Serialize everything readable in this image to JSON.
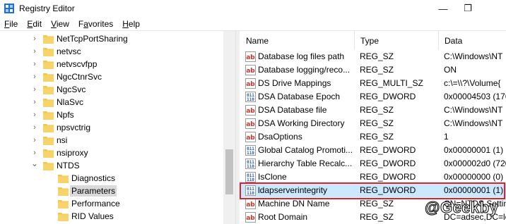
{
  "window": {
    "title": "Registry Editor",
    "controls": [
      "—",
      "❐"
    ]
  },
  "menu": [
    {
      "hotkey": "F",
      "rest": "ile"
    },
    {
      "hotkey": "E",
      "rest": "dit"
    },
    {
      "hotkey": "V",
      "rest": "iew"
    },
    {
      "hotkey": "",
      "rest": "Favorites",
      "u_index": 1
    },
    {
      "hotkey": "H",
      "rest": "elp"
    }
  ],
  "tree": {
    "items": [
      {
        "label": "NetTcpPortSharing",
        "expandable": true,
        "selected": false
      },
      {
        "label": "netvsc",
        "expandable": true,
        "selected": false
      },
      {
        "label": "netvscvfpp",
        "expandable": true,
        "selected": false
      },
      {
        "label": "NgcCtnrSvc",
        "expandable": true,
        "selected": false
      },
      {
        "label": "NgcSvc",
        "expandable": true,
        "selected": false
      },
      {
        "label": "NlaSvc",
        "expandable": true,
        "selected": false
      },
      {
        "label": "Npfs",
        "expandable": true,
        "selected": false
      },
      {
        "label": "npsvctrig",
        "expandable": true,
        "selected": false
      },
      {
        "label": "nsi",
        "expandable": true,
        "selected": false
      },
      {
        "label": "nsiproxy",
        "expandable": true,
        "selected": false
      },
      {
        "label": "NTDS",
        "expandable": true,
        "expanded": true,
        "selected": false
      },
      {
        "label": "Diagnostics",
        "expandable": false,
        "child": true,
        "selected": false
      },
      {
        "label": "Parameters",
        "expandable": false,
        "child": true,
        "selected": true
      },
      {
        "label": "Performance",
        "expandable": false,
        "child": true,
        "selected": false
      },
      {
        "label": "RID Values",
        "expandable": false,
        "child": true,
        "selected": false
      }
    ]
  },
  "list": {
    "columns": [
      "Name",
      "Type",
      "Data"
    ],
    "rows": [
      {
        "icon": "string-value-icon",
        "name": "Database log files path",
        "type": "REG_SZ",
        "data": "C:\\Windows\\NT"
      },
      {
        "icon": "string-value-icon",
        "name": "Database logging/reco...",
        "type": "REG_SZ",
        "data": "ON"
      },
      {
        "icon": "string-value-icon",
        "name": "DS Drive Mappings",
        "type": "REG_MULTI_SZ",
        "data": "c:\\=\\\\?\\Volume{"
      },
      {
        "icon": "binary-value-icon",
        "name": "DSA Database Epoch",
        "type": "REG_DWORD",
        "data": "0x00004503 (1766"
      },
      {
        "icon": "string-value-icon",
        "name": "DSA Database file",
        "type": "REG_SZ",
        "data": "C:\\Windows\\NT"
      },
      {
        "icon": "string-value-icon",
        "name": "DSA Working Directory",
        "type": "REG_SZ",
        "data": "C:\\Windows\\NT"
      },
      {
        "icon": "string-value-icon",
        "name": "DsaOptions",
        "type": "REG_SZ",
        "data": "1"
      },
      {
        "icon": "binary-value-icon",
        "name": "Global Catalog Promoti...",
        "type": "REG_DWORD",
        "data": "0x00000001 (1)"
      },
      {
        "icon": "binary-value-icon",
        "name": "Hierarchy Table Recalc...",
        "type": "REG_DWORD",
        "data": "0x000002d0 (720)"
      },
      {
        "icon": "binary-value-icon",
        "name": "IsClone",
        "type": "REG_DWORD",
        "data": "0x00000000 (0)"
      },
      {
        "icon": "binary-value-icon",
        "name": "ldapserverintegrity",
        "type": "REG_DWORD",
        "data": "0x00000001 (1)",
        "selected": true
      },
      {
        "icon": "string-value-icon",
        "name": "Machine DN Name",
        "type": "REG_SZ",
        "data": "CN=NTDS Settin"
      },
      {
        "icon": "string-value-icon",
        "name": "Root Domain",
        "type": "REG_SZ",
        "data": "DC=adsec,DC=lo"
      }
    ]
  },
  "watermark": "@Geekby",
  "colors": {
    "folder": "#f4c54b",
    "selection": "#cce8ff",
    "highlight_box": "#e0202a",
    "string_icon": "#d0322a",
    "binary_icon": "#2a5bb0"
  }
}
